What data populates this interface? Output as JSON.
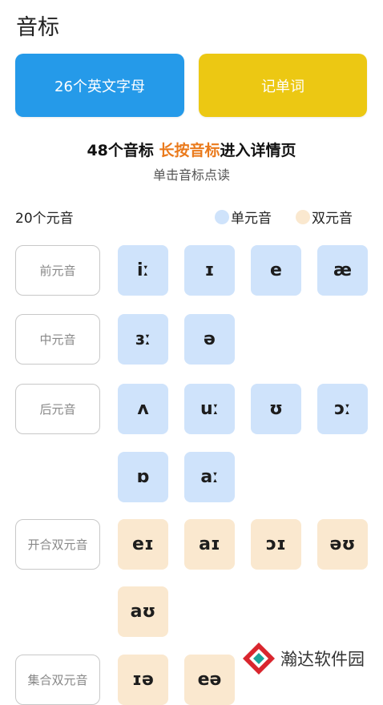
{
  "page": {
    "title": "音标"
  },
  "buttons": {
    "letters_label": "26个英文字母",
    "words_label": "记单词"
  },
  "intro": {
    "headline_prefix": "48个音标",
    "headline_accent": "长按音标",
    "headline_suffix": "进入详情页",
    "subline": "单击音标点读"
  },
  "vowels": {
    "section_label": "20个元音",
    "legend": {
      "single": {
        "label": "单元音",
        "color": "#cfe3fb"
      },
      "double": {
        "label": "双元音",
        "color": "#fae8cf"
      }
    },
    "categories": [
      {
        "label": "前元音",
        "symbols": [
          "iː",
          "ɪ",
          "e",
          "æ"
        ]
      },
      {
        "label": "中元音",
        "symbols": [
          "ɜː",
          "ə"
        ]
      },
      {
        "label": "后元音",
        "symbols": [
          "ʌ",
          "uː",
          "ʊ",
          "ɔː",
          "ɒ",
          "aː"
        ]
      },
      {
        "label": "开合双元音",
        "symbols": [
          "eɪ",
          "aɪ",
          "ɔɪ",
          "əʊ",
          "aʊ"
        ]
      },
      {
        "label": "集合双元音",
        "symbols": [
          "ɪə",
          "eə"
        ]
      }
    ]
  },
  "watermark": {
    "text": "瀚达软件园"
  }
}
